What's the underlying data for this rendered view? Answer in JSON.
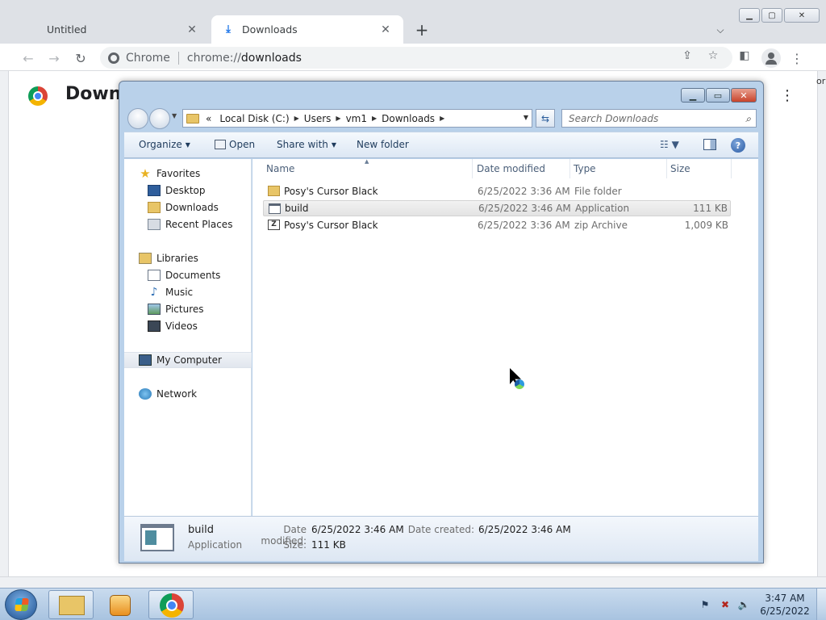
{
  "browser": {
    "tabs": [
      {
        "label": "Untitled"
      },
      {
        "label": "Downloads"
      }
    ],
    "omnibox": {
      "site": "Chrome",
      "url_scheme": "chrome://",
      "url_path": "downloads"
    },
    "page": {
      "title": "Downloads",
      "clipped_right_text": "or"
    }
  },
  "explorer": {
    "breadcrumb": {
      "overflow": "«",
      "items": [
        "Local Disk (C:)",
        "Users",
        "vm1",
        "Downloads"
      ]
    },
    "search_placeholder": "Search Downloads",
    "commands": {
      "organize": "Organize",
      "open": "Open",
      "share_with": "Share with",
      "new_folder": "New folder"
    },
    "nav": {
      "favorites": "Favorites",
      "desktop": "Desktop",
      "downloads": "Downloads",
      "recent_places": "Recent Places",
      "libraries": "Libraries",
      "documents": "Documents",
      "music": "Music",
      "pictures": "Pictures",
      "videos": "Videos",
      "my_computer": "My Computer",
      "network": "Network"
    },
    "columns": {
      "name": "Name",
      "date_modified": "Date modified",
      "type": "Type",
      "size": "Size"
    },
    "files": [
      {
        "name": "Posy's Cursor Black",
        "date": "6/25/2022 3:36 AM",
        "type": "File folder",
        "size": ""
      },
      {
        "name": "build",
        "date": "6/25/2022 3:46 AM",
        "type": "Application",
        "size": "111 KB"
      },
      {
        "name": "Posy's Cursor Black",
        "date": "6/25/2022 3:36 AM",
        "type": "zip Archive",
        "size": "1,009 KB"
      }
    ],
    "details": {
      "name": "build",
      "type": "Application",
      "date_modified_label": "Date modified:",
      "date_modified": "6/25/2022 3:46 AM",
      "size_label": "Size:",
      "size": "111 KB",
      "date_created_label": "Date created:",
      "date_created": "6/25/2022 3:46 AM"
    }
  },
  "taskbar": {
    "time": "3:47 AM",
    "date": "6/25/2022"
  }
}
